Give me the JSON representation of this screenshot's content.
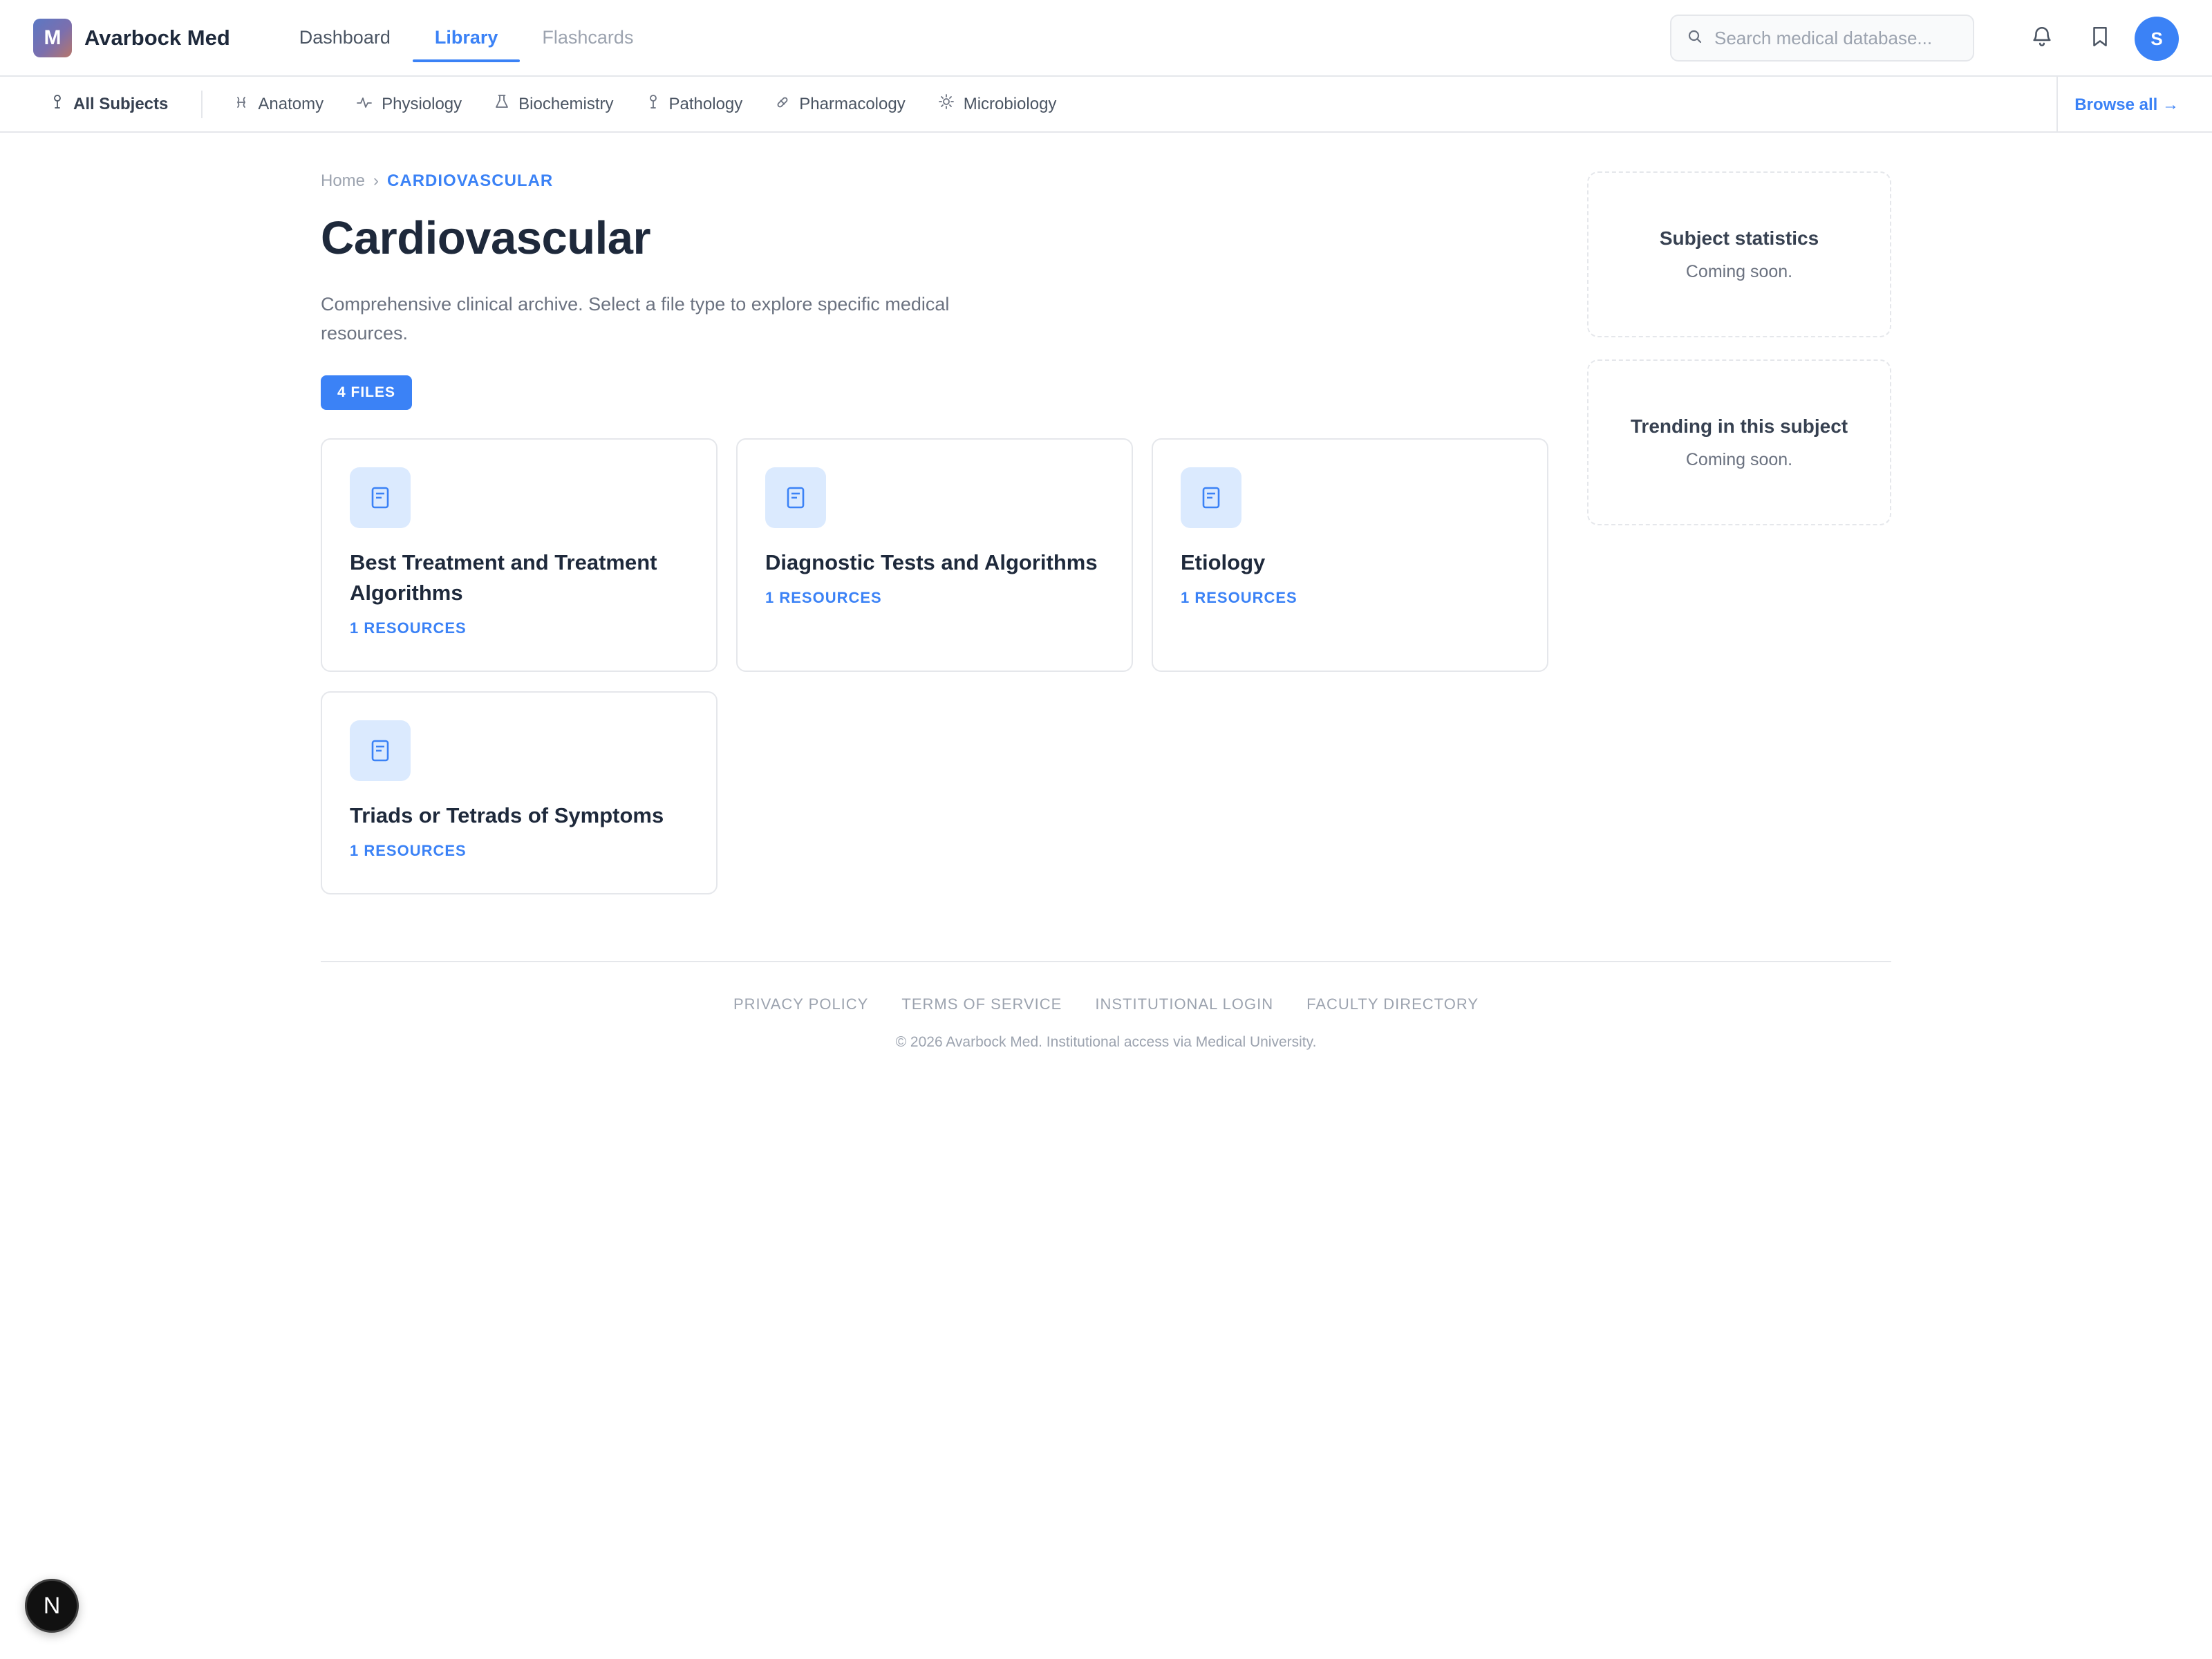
{
  "brand": {
    "logo_letter": "M",
    "name": "Avarbock Med"
  },
  "nav": {
    "items": [
      {
        "label": "Dashboard"
      },
      {
        "label": "Library",
        "active": true
      },
      {
        "label": "Flashcards"
      }
    ]
  },
  "search": {
    "placeholder": "Search medical database..."
  },
  "header_icons": [
    "bell-icon",
    "bookmark-icon"
  ],
  "user": {
    "initial": "S"
  },
  "subjects": {
    "items": [
      {
        "label": "All Subjects",
        "icon": "person-icon"
      },
      {
        "label": "Anatomy",
        "icon": "bone-icon"
      },
      {
        "label": "Physiology",
        "icon": "pulse-icon"
      },
      {
        "label": "Biochemistry",
        "icon": "flask-icon"
      },
      {
        "label": "Pathology",
        "icon": "microscope-icon"
      },
      {
        "label": "Pharmacology",
        "icon": "pill-icon"
      },
      {
        "label": "Microbiology",
        "icon": "sun-icon"
      }
    ],
    "browse_all": "Browse all →"
  },
  "breadcrumb": {
    "home": "Home",
    "separator": "›",
    "current": "CARDIOVASCULAR"
  },
  "page": {
    "title": "Cardiovascular",
    "description": "Comprehensive clinical archive. Select a file type to explore specific medical resources.",
    "file_count": "4 FILES"
  },
  "cards": [
    {
      "title": "Best Treatment and Treatment Algorithms",
      "resources": "1 RESOURCES"
    },
    {
      "title": "Diagnostic Tests and Algorithms",
      "resources": "1 RESOURCES"
    },
    {
      "title": "Etiology",
      "resources": "1 RESOURCES"
    },
    {
      "title": "Triads or Tetrads of Symptoms",
      "resources": "1 RESOURCES"
    }
  ],
  "sidebar": {
    "stats": {
      "title": "Subject statistics",
      "subtitle": "Coming soon."
    },
    "trending": {
      "title": "Trending in this subject",
      "subtitle": "Coming soon."
    }
  },
  "footer": {
    "links": [
      "PRIVACY POLICY",
      "TERMS OF SERVICE",
      "INSTITUTIONAL LOGIN",
      "FACULTY DIRECTORY"
    ],
    "copyright": "© 2026 Avarbock Med. Institutional access via Medical University."
  },
  "dev_badge": "N",
  "colors": {
    "accent": "#3b82f6",
    "text": "#1e293b",
    "muted": "#6b7280",
    "border": "#e5e7eb"
  }
}
